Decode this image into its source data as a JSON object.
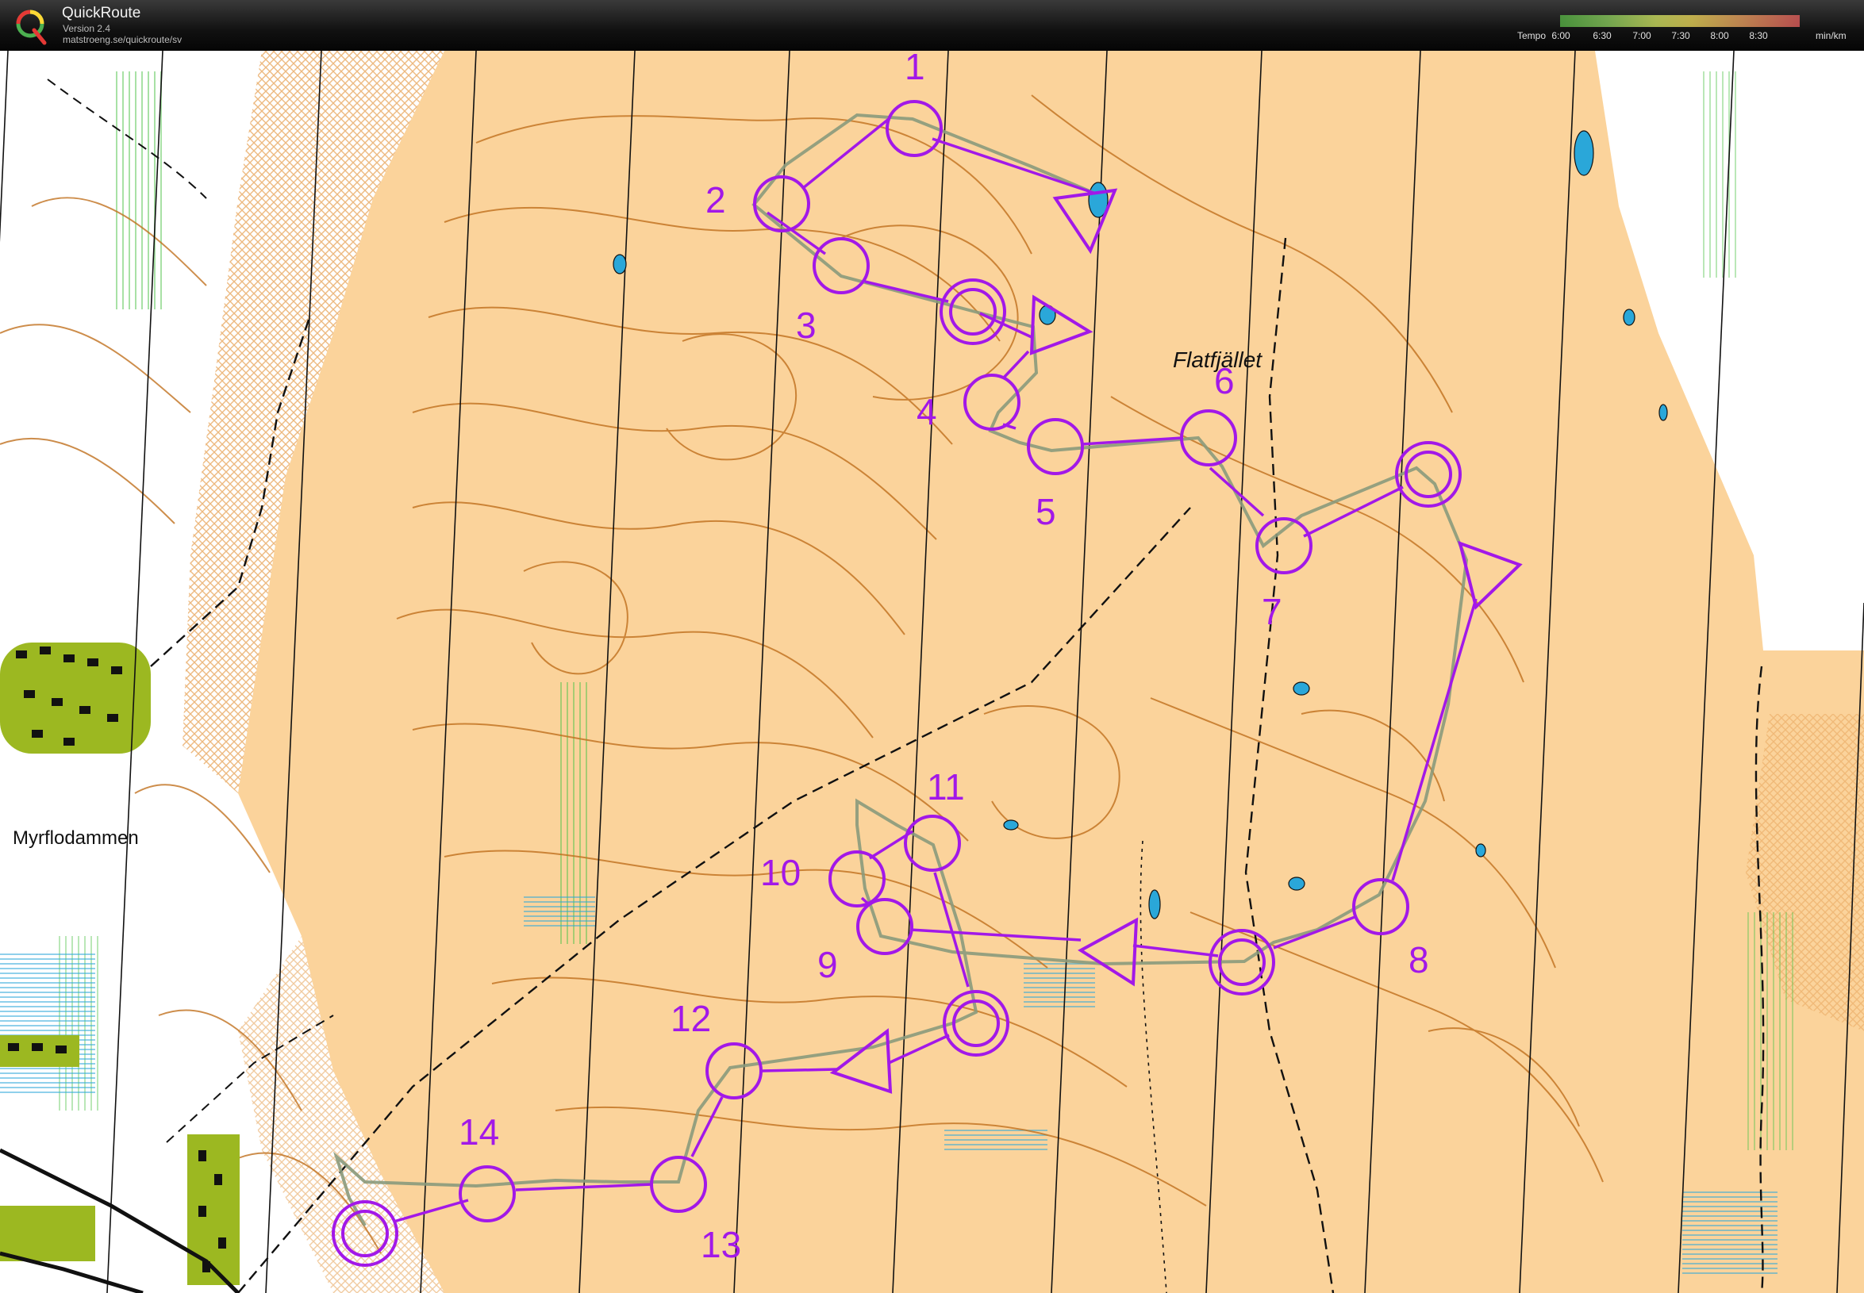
{
  "app": {
    "title": "QuickRoute",
    "version": "Version 2.4",
    "url": "matstroeng.se/quickroute/sv",
    "logo_letter": "Q"
  },
  "legend": {
    "title": "Tempo",
    "ticks": [
      "6:00",
      "6:30",
      "7:00",
      "7:30",
      "8:00",
      "8:30"
    ],
    "unit": "min/km"
  },
  "map": {
    "place_names": [
      {
        "id": "flatfjallet",
        "text": "Flatfjället"
      },
      {
        "id": "myrflodammen",
        "text": "Myrflodammen"
      }
    ],
    "controls": [
      {
        "n": "1",
        "type": "circle"
      },
      {
        "n": "2",
        "type": "circle"
      },
      {
        "n": "3",
        "type": "circle"
      },
      {
        "n": "4",
        "type": "circle"
      },
      {
        "n": "5",
        "type": "circle"
      },
      {
        "n": "6",
        "type": "circle"
      },
      {
        "n": "7",
        "type": "circle"
      },
      {
        "n": "8",
        "type": "circle"
      },
      {
        "n": "9",
        "type": "circle"
      },
      {
        "n": "10",
        "type": "circle"
      },
      {
        "n": "11",
        "type": "circle"
      },
      {
        "n": "12",
        "type": "circle"
      },
      {
        "n": "13",
        "type": "circle"
      },
      {
        "n": "14",
        "type": "circle"
      }
    ],
    "course_color": "#a218e8",
    "terrain_color": "#fbd39b",
    "contour_color": "#c0701e",
    "route_color": "#8a9a7c"
  }
}
